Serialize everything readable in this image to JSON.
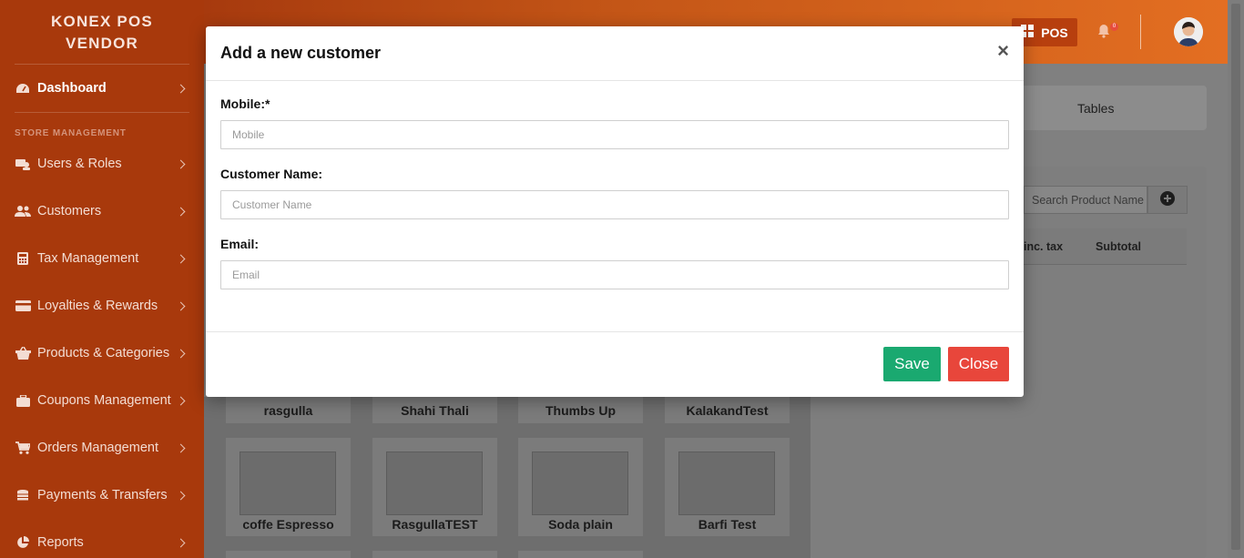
{
  "brand": {
    "line1": "KONEX POS",
    "line2": "VENDOR"
  },
  "sidebar": {
    "dashboard": "Dashboard",
    "section_title": "STORE MANAGEMENT",
    "items": [
      {
        "label": "Users & Roles",
        "icon": "users-roles-icon"
      },
      {
        "label": "Customers",
        "icon": "customers-icon"
      },
      {
        "label": "Tax Management",
        "icon": "calculator-icon"
      },
      {
        "label": "Loyalties & Rewards",
        "icon": "credit-card-icon"
      },
      {
        "label": "Products & Categories",
        "icon": "basket-icon"
      },
      {
        "label": "Coupons Management",
        "icon": "briefcase-icon"
      },
      {
        "label": "Orders Management",
        "icon": "cart-icon"
      },
      {
        "label": "Payments & Transfers",
        "icon": "coins-icon"
      },
      {
        "label": "Reports",
        "icon": "pie-chart-icon"
      }
    ]
  },
  "topbar": {
    "pos_label": "POS",
    "notification_count": "0"
  },
  "background": {
    "tab_tables": "Tables",
    "search_placeholder": "Search Product Name",
    "col_inc_tax": "inc. tax",
    "col_subtotal": "Subtotal",
    "products_row1": [
      "rasgulla",
      "Shahi Thali",
      "Thumbs Up",
      "KalakandTest"
    ],
    "products_row2": [
      "coffe Espresso",
      "RasgullaTEST",
      "Soda plain",
      "Barfi Test"
    ]
  },
  "modal": {
    "title": "Add a new customer",
    "close_symbol": "×",
    "mobile_label": "Mobile:*",
    "mobile_placeholder": "Mobile",
    "name_label": "Customer Name:",
    "name_placeholder": "Customer Name",
    "email_label": "Email:",
    "email_placeholder": "Email",
    "save_label": "Save",
    "close_label": "Close"
  },
  "colors": {
    "sidebar": "#a8390c",
    "save": "#1aa970",
    "close": "#e8463b"
  }
}
